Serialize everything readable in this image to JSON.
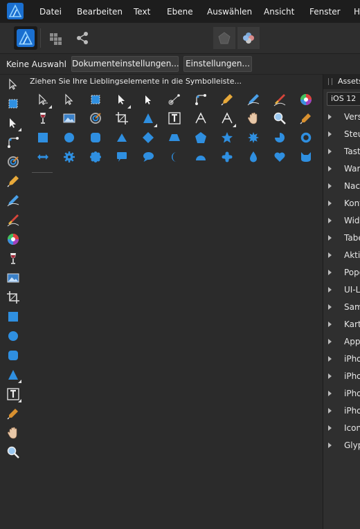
{
  "menubar": {
    "items": [
      "Datei",
      "Bearbeiten",
      "Text",
      "Ebene",
      "Auswählen",
      "Ansicht",
      "Fenster",
      "H"
    ]
  },
  "context": {
    "selection_label": "Keine Auswahl",
    "document_settings_label": "Dokumenteinstellungen...",
    "settings_label": "Einstellungen..."
  },
  "customize": {
    "hint": "Ziehen Sie Ihre Lieblingselemente in die Symbolleiste...",
    "tools": [
      "move-tool-icon",
      "node-tool-icon",
      "artboard-tool-icon",
      "point-transform-tool-icon",
      "corner-tool-icon",
      "contour-tool-icon",
      "pen-tool-icon",
      "pencil-tool-icon",
      "vector-brush-tool-icon",
      "fill-tool-icon",
      "transparency-tool-icon",
      "place-image-tool-icon",
      "vector-crop-tool-icon",
      "crop-tool-icon",
      "triangle-tool-icon",
      "frame-text-tool-icon",
      "artistic-text-tool-icon",
      "text-style-tool-icon",
      "view-tool-icon",
      "zoom-tool-icon",
      "color-picker-tool-icon",
      "rectangle-tool-icon",
      "ellipse-tool-icon",
      "rounded-rectangle-tool-icon",
      "triangle-shape-icon",
      "diamond-tool-icon",
      "trapezoid-tool-icon",
      "polygon-tool-icon",
      "star-tool-icon",
      "burst-tool-icon",
      "pie-tool-icon",
      "donut-tool-icon",
      "double-arrow-tool-icon",
      "cog-tool-icon",
      "flower-tool-icon",
      "square-callout-tool-icon",
      "round-callout-tool-icon",
      "crescent-tool-icon",
      "segment-tool-icon",
      "cloud-tool-icon",
      "tear-tool-icon",
      "heart-tool-icon",
      "cat-tool-icon"
    ]
  },
  "left_toolbar": {
    "tools": [
      "move-tool-icon",
      "artboard-tool-icon",
      "node-tool-icon",
      "corner-tool-icon",
      "fill-tool-icon",
      "pen-tool-icon",
      "pencil-tool-icon",
      "vector-brush-tool-icon",
      "color-wheel-tool-icon",
      "transparency-tool-icon",
      "place-image-tool-icon",
      "crop-tool-icon",
      "rectangle-tool-icon",
      "ellipse-tool-icon",
      "rounded-rectangle-tool-icon",
      "triangle-tool-icon",
      "frame-text-tool-icon",
      "color-picker-tool-icon",
      "view-tool-icon",
      "zoom-tool-icon"
    ]
  },
  "assets_panel": {
    "tab_label": "Assets",
    "selected_set": "iOS 12",
    "items": [
      "Versc",
      "Steue",
      "Tasta",
      "Warn",
      "Nach",
      "Kont",
      "Widg",
      "Tabe",
      "Aktiv",
      "Popo",
      "UI-Le",
      "Samr",
      "Karte",
      "Appl",
      "iPho",
      "iPho",
      "iPho",
      "iPho",
      "Icons",
      "Glyp"
    ]
  },
  "colors": {
    "accent_blue": "#2f8fe0",
    "menubar": "#1d1d1d",
    "background": "#2b2b2b"
  }
}
